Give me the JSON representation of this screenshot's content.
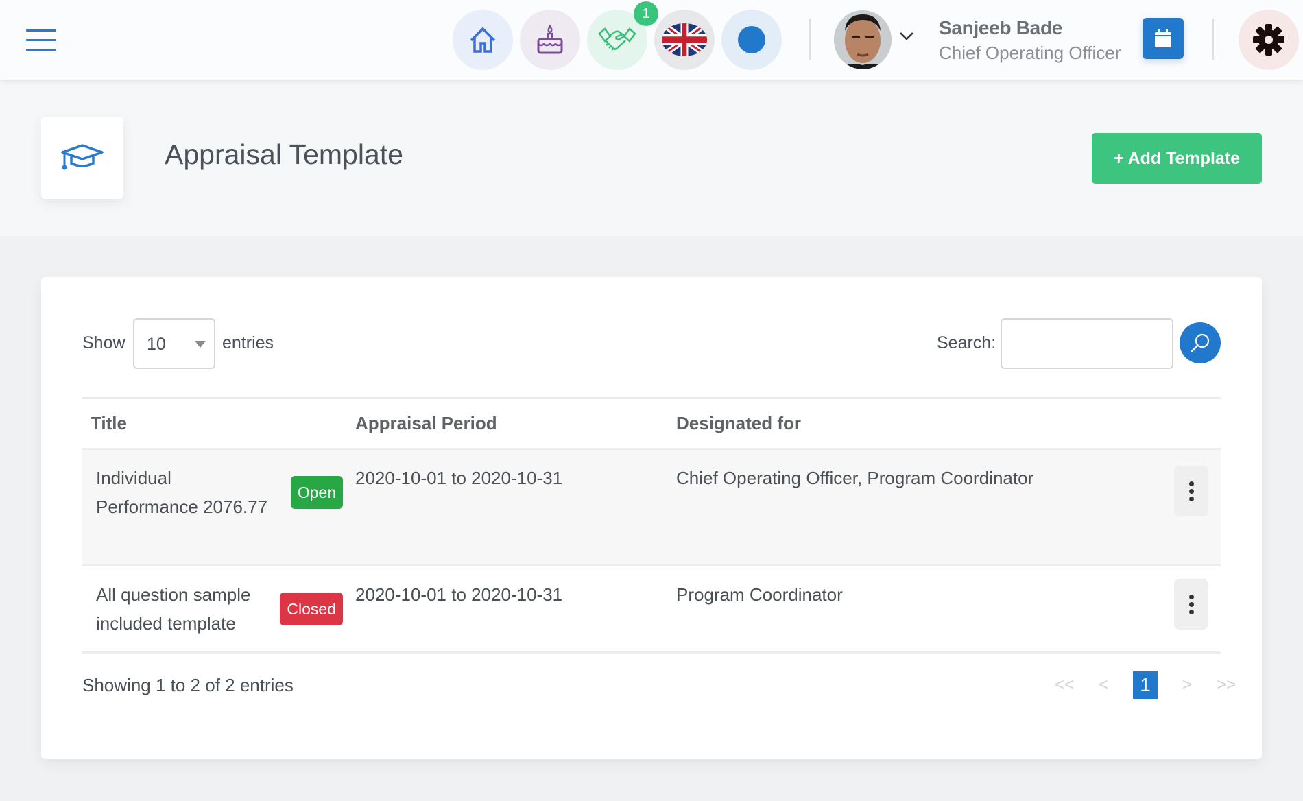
{
  "header": {
    "notification_count": "1",
    "user_name": "Sanjeeb Bade",
    "user_role": "Chief Operating Officer",
    "icons": [
      "menu-icon",
      "home-icon",
      "birthday-cake-icon",
      "handshake-icon",
      "uk-flag-icon",
      "status-dot-icon",
      "chevron-down-icon",
      "calendar-icon",
      "gear-icon"
    ]
  },
  "page": {
    "title": "Appraisal Template",
    "icon": "graduation-cap-icon",
    "add_button_label": "+ Add Template"
  },
  "table_controls": {
    "show_label": "Show",
    "page_length": "10",
    "entries_label": "entries",
    "search_label": "Search:",
    "search_value": "",
    "search_placeholder": ""
  },
  "table": {
    "columns": [
      "Title",
      "Appraisal Period",
      "Designated for"
    ],
    "rows": [
      {
        "title": "Individual Performance 2076.77",
        "status": "Open",
        "period": "2020-10-01 to 2020-10-31",
        "designated": "Chief Operating Officer, Program Coordinator"
      },
      {
        "title": "All question sample included template",
        "status": "Closed",
        "period": "2020-10-01 to 2020-10-31",
        "designated": "Program Coordinator"
      }
    ]
  },
  "footer": {
    "info": "Showing 1 to 2 of 2 entries",
    "pagination": {
      "first": "<<",
      "prev": "<",
      "current": "1",
      "next": ">",
      "last": ">>"
    }
  },
  "colors": {
    "primary": "#2279cb",
    "success": "#3dc47e",
    "open": "#28a745",
    "closed": "#dc3545"
  }
}
